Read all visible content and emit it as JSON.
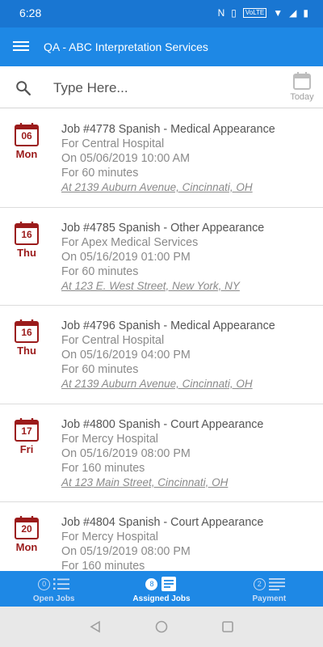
{
  "statusbar": {
    "time": "6:28",
    "network": "VoLTE"
  },
  "appbar": {
    "title": "QA - ABC Interpretation Services"
  },
  "search": {
    "placeholder": "Type Here...",
    "value": "",
    "today_label": "Today"
  },
  "jobs": [
    {
      "date": "06",
      "day": "Mon",
      "title": "Job #4778 Spanish - Medical Appearance",
      "for": "For Central Hospital",
      "on": "On 05/06/2019 10:00 AM",
      "duration": "For 60 minutes",
      "address": "At 2139 Auburn Avenue, Cincinnati, OH"
    },
    {
      "date": "16",
      "day": "Thu",
      "title": "Job #4785 Spanish - Other Appearance",
      "for": "For Apex Medical Services",
      "on": "On 05/16/2019 01:00 PM",
      "duration": "For 60 minutes",
      "address": "At 123 E. West Street, New York, NY"
    },
    {
      "date": "16",
      "day": "Thu",
      "title": "Job #4796 Spanish - Medical Appearance",
      "for": "For Central Hospital",
      "on": "On 05/16/2019 04:00 PM",
      "duration": "For 60 minutes",
      "address": "At 2139 Auburn Avenue, Cincinnati, OH"
    },
    {
      "date": "17",
      "day": "Fri",
      "title": "Job #4800 Spanish - Court Appearance",
      "for": "For Mercy Hospital",
      "on": "On 05/16/2019 08:00 PM",
      "duration": "For 160 minutes",
      "address": "At 123 Main Street, Cincinnati, OH"
    },
    {
      "date": "20",
      "day": "Mon",
      "title": "Job #4804 Spanish - Court Appearance",
      "for": "For Mercy Hospital",
      "on": "On 05/19/2019 08:00 PM",
      "duration": "For 160 minutes",
      "address": ""
    }
  ],
  "bottomnav": {
    "tabs": [
      {
        "label": "Open Jobs",
        "count": "0",
        "active": false
      },
      {
        "label": "Assigned Jobs",
        "count": "8",
        "active": true
      },
      {
        "label": "Payment",
        "count": "2",
        "active": false
      }
    ]
  },
  "colors": {
    "primary": "#1e88e5",
    "statusbar": "#1976d2",
    "calendar": "#9b1b1b"
  }
}
